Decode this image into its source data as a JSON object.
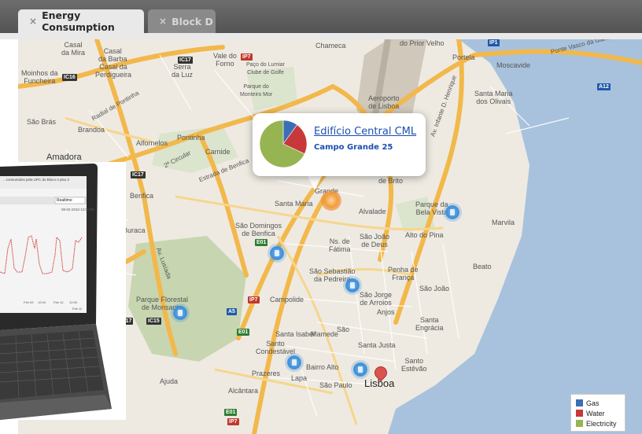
{
  "tabs": [
    {
      "label": "Energy Consumption",
      "close": "×",
      "active": true
    },
    {
      "label": "Block D",
      "close": "×",
      "active": false
    }
  ],
  "map": {
    "labels": {
      "casal_mira": "Casal\nda Mira",
      "casal_barba": "Casal\nda Barba",
      "casal_perdigueira": "Casal da\nPerdigueira",
      "moinhos": "Moinhos da\nFuncheira",
      "serra_luz": "Serra\nda Luz",
      "vale_forno": "Vale do\nForno",
      "chamecca": "Chameca",
      "prior_velho": "do Prior Velho",
      "portela": "Portela",
      "moscavide": "Moscavide",
      "aeroporto": "Aeroporto\nde Lisboa",
      "santa_maria": "Santa Maria\ndos Olivais",
      "sao_bras": "São Brás",
      "brandoa": "Brandoa",
      "amadora": "Amadora",
      "alfornelos": "Alfornelos",
      "pontinha": "Pontinha",
      "carnide": "Carnide",
      "benfica": "Benfica",
      "buraca": "Buraca",
      "brito": "de Brito",
      "alvalade": "Alvalade",
      "bela_vista": "Parque da\nBela Vista",
      "marvila": "Marvila",
      "sao_domingos": "São Domingos\nde Benfica",
      "fatima": "Ns. de\nFátima",
      "sao_joao_deus": "São João\nde Deus",
      "alto_pina": "Alto do Pina",
      "beato": "Beato",
      "campolide": "Campolide",
      "sao_sebastiao": "São Sebastião\nda Pedreira",
      "penha": "Penha de\nFrança",
      "sao_joao": "São João",
      "parque_florestal": "Parque Florestal\nde Monsanto",
      "arroios": "São Jorge\nde Arroios",
      "anjos": "Anjos",
      "santa_engracia": "Santa\nEngrácia",
      "santa_isabel": "Santa Isabel",
      "mamede": "Mamede",
      "sao": "São",
      "condestavel": "Santo\nCondestável",
      "santa_justa": "Santa Justa",
      "prazeres": "Prazeres",
      "lapa": "Lapa",
      "bairro_alto": "Bairro Alto",
      "ajuda": "Ajuda",
      "alcantara": "Alcântara",
      "sao_paulo": "São Paulo",
      "lisboa": "Lisboa",
      "santo_estevao": "Santo\nEstêvão",
      "grande": "Grande",
      "santa_maria_small": "Santa Maria",
      "clube_golfe": "Paço do Lumiar\nClube de Golfe",
      "parque_monteiro": "Parque do\nMonteiro Mor"
    },
    "road_tags": {
      "ic17a": "IC17",
      "ic16": "IC16",
      "ip7a": "IP7",
      "ic17b": "IC17",
      "ip1": "IP1",
      "a12": "A12",
      "e01a": "E01",
      "ip7b": "IP7",
      "n117": "N117",
      "ic15": "IC15",
      "a5": "A5",
      "e01b": "E01",
      "e01c": "E01",
      "ip7c": "IP7",
      "ponte": "Ponte Vasco da Gama"
    },
    "road_names": {
      "r1": "Av. Infante D. Henrique",
      "r2": "2ª Circular",
      "r3": "Radial de Pontinha",
      "r4": "Estrada de Benfica",
      "r5": "Av. Lusíada"
    }
  },
  "popup": {
    "title": "Edifício Central CML",
    "subtitle": "Campo Grande 25"
  },
  "chart_data": {
    "type": "pie",
    "title": "",
    "categories": [
      "Gas",
      "Water",
      "Electricity"
    ],
    "values": [
      0.1,
      0.22,
      0.68
    ],
    "colors": [
      "#3a6fb5",
      "#c8383a",
      "#97b452"
    ]
  },
  "legend": {
    "items": [
      {
        "label": "Gas",
        "color": "#3a6fb5"
      },
      {
        "label": "Water",
        "color": "#c8383a"
      },
      {
        "label": "Electricity",
        "color": "#97b452"
      }
    ]
  },
  "laptop_screen": {
    "header_text": "...consumidos pela UPC do Bloco A piso 2",
    "dropdown_value": "Realtime",
    "timestamp": "08-02-2010 12:00:00",
    "x_labels": [
      "Feb 09",
      "12:00",
      "Feb 10",
      "12:00"
    ],
    "footer": "Feb 11",
    "line_color": "#d43a3a"
  }
}
